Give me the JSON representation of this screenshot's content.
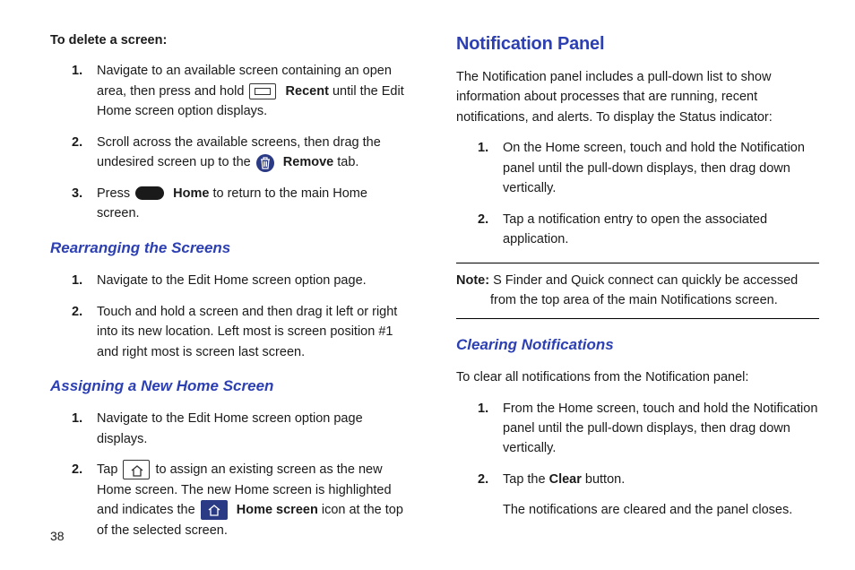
{
  "pageNumber": "38",
  "left": {
    "deleteHeading": "To delete a screen:",
    "deleteSteps": [
      {
        "num": "1.",
        "pre": "Navigate to an available screen containing an open area, then press and hold ",
        "bold": "Recent",
        "post": " until the Edit Home screen option displays."
      },
      {
        "num": "2.",
        "pre": "Scroll across the available screens, then drag the undesired screen up to the ",
        "bold": "Remove",
        "post": " tab."
      },
      {
        "num": "3.",
        "pre": "Press ",
        "bold": "Home",
        "post": " to return to the main Home screen."
      }
    ],
    "rearrangingHeading": "Rearranging the Screens",
    "rearrangingSteps": [
      {
        "num": "1.",
        "text": "Navigate to the Edit Home screen option page."
      },
      {
        "num": "2.",
        "text": "Touch and hold a screen and then drag it left or right into its new location. Left most is screen position #1 and right most is screen last screen."
      }
    ],
    "assigningHeading": "Assigning a New Home Screen",
    "assigningSteps": [
      {
        "num": "1.",
        "text": "Navigate to the Edit Home screen option page displays."
      },
      {
        "num": "2.",
        "pre": "Tap ",
        "mid": " to assign an existing screen as the new Home screen. The new Home screen is highlighted and indicates the ",
        "bold": "Home screen",
        "post": " icon at the top of the selected screen."
      }
    ]
  },
  "right": {
    "panelHeading": "Notification Panel",
    "panelIntro": "The Notification panel includes a pull-down list to show information about processes that are running, recent notifications, and alerts. To display the Status indicator:",
    "panelSteps": [
      {
        "num": "1.",
        "text": "On the Home screen, touch and hold the Notification panel until the pull-down displays, then drag down vertically."
      },
      {
        "num": "2.",
        "text": "Tap a notification entry to open the associated application."
      }
    ],
    "noteLabel": "Note:",
    "noteLine1": " S Finder and Quick connect can quickly be accessed",
    "noteLine2": "from the top area of the main Notifications screen.",
    "clearingHeading": "Clearing Notifications",
    "clearingIntro": "To clear all notifications from the Notification panel:",
    "clearingSteps": [
      {
        "num": "1.",
        "text": "From the Home screen, touch and hold the Notification panel until the pull-down displays, then drag down vertically."
      },
      {
        "num": "2.",
        "pre": "Tap the ",
        "bold": "Clear",
        "post": " button."
      }
    ],
    "clearingOutro": "The notifications are cleared and the panel closes."
  }
}
